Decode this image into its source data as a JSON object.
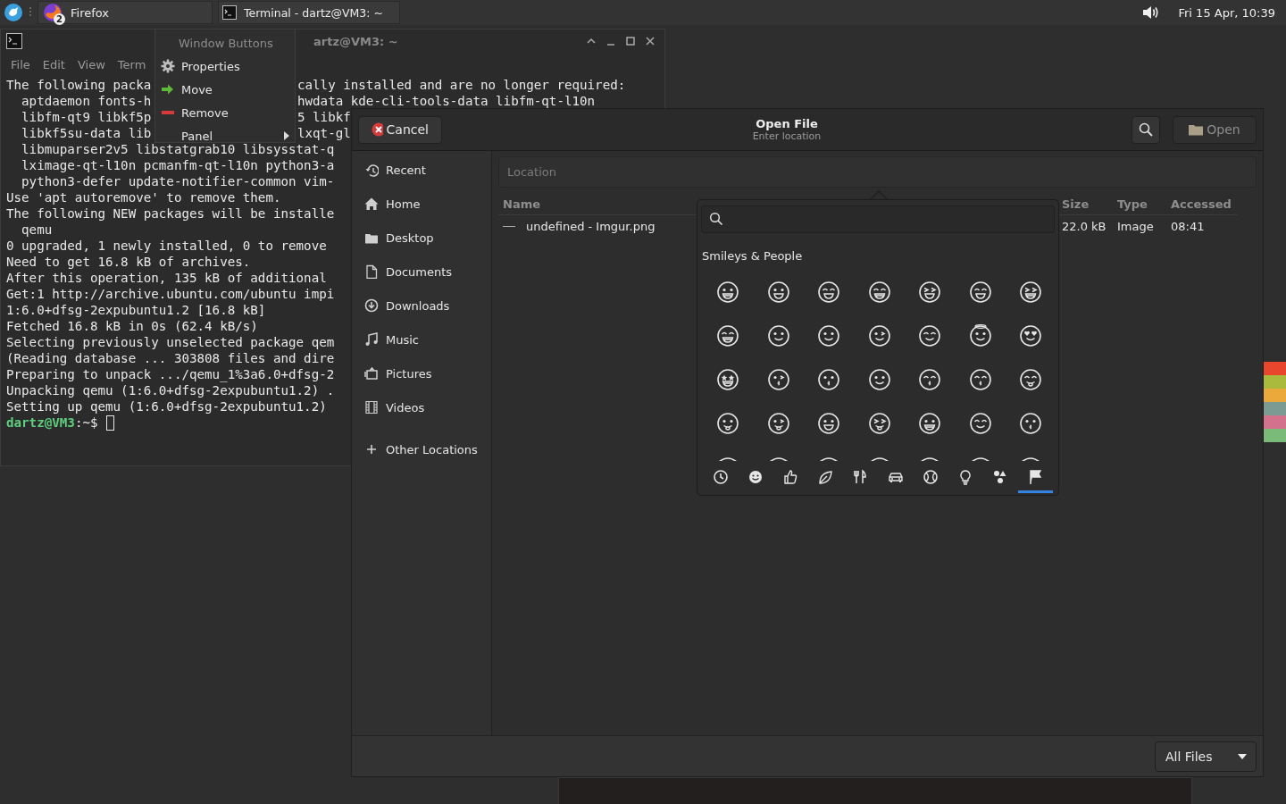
{
  "taskbar": {
    "tasks": [
      {
        "label": "Firefox",
        "badge": "2"
      },
      {
        "label": "Terminal - dartz@VM3: ~"
      }
    ],
    "clock": "Fri 15 Apr, 10:39"
  },
  "terminal": {
    "title": "artz@VM3: ~",
    "menu": [
      "File",
      "Edit",
      "View",
      "Term"
    ],
    "lines": [
      {
        "left": "The following packa",
        "right": "cally installed and are no longer required:"
      },
      {
        "left": "  aptdaemon fonts-h",
        "right": "hwdata kde-cli-tools-data libfm-qt-l10n"
      },
      {
        "left": "  libfm-qt9 libkf5p",
        "right": "5 libkf"
      },
      {
        "left": "  libkf5su-data lib",
        "right": "lxqt-gl"
      },
      {
        "left": "  libmuparser2v5 libstatgrab10 libsysstat-q"
      },
      {
        "left": "  lximage-qt-l10n pcmanfm-qt-l10n python3-a"
      },
      {
        "left": "  python3-defer update-notifier-common vim-"
      },
      {
        "left": "Use 'apt autoremove' to remove them."
      },
      {
        "left": "The following NEW packages will be installe"
      },
      {
        "left": "  qemu"
      },
      {
        "left": "0 upgraded, 1 newly installed, 0 to remove"
      },
      {
        "left": "Need to get 16.8 kB of archives."
      },
      {
        "left": "After this operation, 135 kB of additional"
      },
      {
        "left": "Get:1 http://archive.ubuntu.com/ubuntu impi"
      },
      {
        "left": "1:6.0+dfsg-2expubuntu1.2 [16.8 kB]"
      },
      {
        "left": "Fetched 16.8 kB in 0s (62.4 kB/s)"
      },
      {
        "left": "Selecting previously unselected package qem"
      },
      {
        "left": "(Reading database ... 303808 files and dire"
      },
      {
        "left": "Preparing to unpack .../qemu_1%3a6.0+dfsg-2"
      },
      {
        "left": "Unpacking qemu (1:6.0+dfsg-2expubuntu1.2) ."
      },
      {
        "left": "Setting up qemu (1:6.0+dfsg-2expubuntu1.2)"
      }
    ],
    "prompt": {
      "user": "dartz@VM3",
      "path": ":~$"
    }
  },
  "context_menu": {
    "header": "Window Buttons",
    "items": [
      {
        "label": "Properties",
        "submenu": false
      },
      {
        "label": "Move",
        "submenu": false
      },
      {
        "label": "Remove",
        "submenu": false
      },
      {
        "label": "Panel",
        "submenu": true
      }
    ]
  },
  "dialog": {
    "cancel": "Cancel",
    "title": "Open File",
    "subtitle": "Enter location",
    "open": {
      "label": "Open",
      "disabled": true
    },
    "places": [
      "Recent",
      "Home",
      "Desktop",
      "Documents",
      "Downloads",
      "Music",
      "Pictures",
      "Videos"
    ],
    "other_locations": "Other Locations",
    "location_placeholder": "Location",
    "columns": [
      "Name",
      "Size",
      "Type",
      "Accessed"
    ],
    "rows": [
      {
        "name": "undefined - Imgur.png",
        "size": "22.0 kB",
        "type": "Image",
        "accessed": "08:41"
      }
    ],
    "filter": "All Files"
  },
  "emoji_picker": {
    "section": "Smileys & People",
    "categories": [
      {
        "selected": false
      },
      {
        "selected": false
      },
      {
        "selected": false
      },
      {
        "selected": false
      },
      {
        "selected": false
      },
      {
        "selected": false
      },
      {
        "selected": false
      },
      {
        "selected": false
      },
      {
        "selected": false
      },
      {
        "selected": true
      }
    ]
  }
}
